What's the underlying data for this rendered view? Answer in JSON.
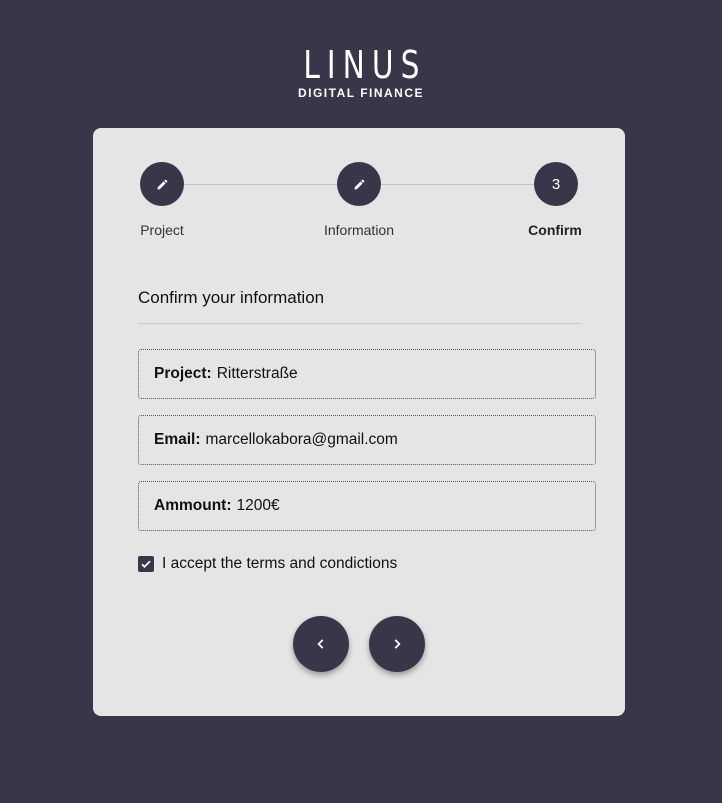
{
  "brand": {
    "name": "LINUS",
    "tagline": "DIGITAL FINANCE"
  },
  "stepper": {
    "steps": [
      {
        "label": "Project",
        "icon": "pencil-icon",
        "state": "done"
      },
      {
        "label": "Information",
        "icon": "pencil-icon",
        "state": "done"
      },
      {
        "label": "Confirm",
        "number": "3",
        "state": "active"
      }
    ]
  },
  "form": {
    "title": "Confirm your information",
    "fields": [
      {
        "label": "Project:",
        "value": "Ritterstraße"
      },
      {
        "label": "Email:",
        "value": "marcellokabora@gmail.com"
      },
      {
        "label": "Ammount:",
        "value": "1200€"
      }
    ],
    "terms": {
      "label": "I accept the terms and condictions",
      "checked": true
    }
  },
  "nav": {
    "back_icon": "chevron-left-icon",
    "next_icon": "chevron-right-icon"
  },
  "colors": {
    "background": "#383649",
    "card": "#e5e5e5",
    "accent": "#383649"
  }
}
